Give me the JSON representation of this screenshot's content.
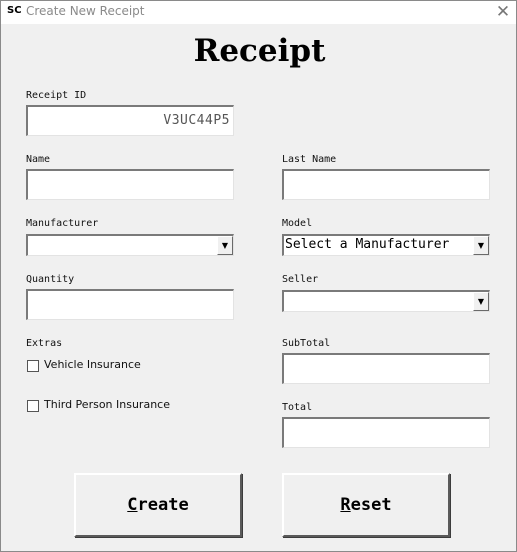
{
  "window": {
    "app_icon": "SC",
    "title": "Create New Receipt",
    "close_glyph": "✕"
  },
  "heading": "Receipt",
  "fields": {
    "receipt_id": {
      "label": "Receipt ID",
      "value": "V3UC44P5"
    },
    "name": {
      "label": "Name",
      "value": ""
    },
    "last_name": {
      "label": "Last Name",
      "value": ""
    },
    "manufacturer": {
      "label": "Manufacturer",
      "selected": ""
    },
    "model": {
      "label": "Model",
      "selected": "Select a Manufacturer"
    },
    "quantity": {
      "label": "Quantity",
      "value": ""
    },
    "seller": {
      "label": "Seller",
      "selected": ""
    },
    "subtotal": {
      "label": "SubTotal",
      "value": ""
    },
    "total": {
      "label": "Total",
      "value": ""
    }
  },
  "extras": {
    "label": "Extras",
    "options": [
      {
        "label": "Vehicle Insurance",
        "checked": false
      },
      {
        "label": "Third Person Insurance",
        "checked": false
      }
    ]
  },
  "buttons": {
    "create": {
      "accel": "C",
      "rest": "reate"
    },
    "reset": {
      "accel": "R",
      "rest": "eset"
    }
  },
  "icons": {
    "dropdown": "chevron-down-icon",
    "close": "close-icon",
    "app": "app-icon"
  }
}
